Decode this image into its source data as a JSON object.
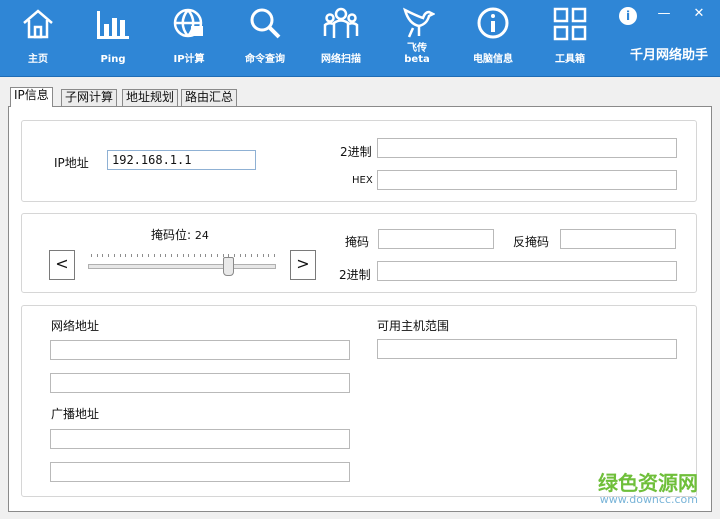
{
  "toolbar": {
    "items": [
      {
        "label": "主页",
        "icon": "home-icon"
      },
      {
        "label": "Ping",
        "icon": "bar-chart-icon"
      },
      {
        "label": "IP计算",
        "icon": "globe-icon"
      },
      {
        "label": "命令查询",
        "icon": "search-icon"
      },
      {
        "label": "网络扫描",
        "icon": "people-icon"
      },
      {
        "label_line1": "飞传",
        "label_line2": "beta",
        "icon": "dove-icon"
      },
      {
        "label": "电脑信息",
        "icon": "info-icon"
      },
      {
        "label": "工具箱",
        "icon": "grid-icon"
      }
    ],
    "brand": "千月网络助手",
    "info_button": "i",
    "minimize_button": "—",
    "close_button": "✕"
  },
  "tabs": [
    "IP信息",
    "子网计算",
    "地址规划",
    "路由汇总"
  ],
  "ip_section": {
    "ip_label": "IP地址",
    "ip_value": "192.168.1.1",
    "binary_label": "2进制",
    "binary_value": "",
    "hex_label": "HEX",
    "hex_value": ""
  },
  "mask_section": {
    "mask_bits_label": "掩码位:",
    "mask_bits_value": "24",
    "mask_bits_max": 32,
    "prev_button": "<",
    "next_button": ">",
    "mask_label": "掩码",
    "mask_value": "",
    "inverse_mask_label": "反掩码",
    "inverse_mask_value": "",
    "binary_label": "2进制",
    "binary_value": ""
  },
  "result_section": {
    "network_label": "网络地址",
    "broadcast_label": "广播地址",
    "host_range_label": "可用主机范围"
  },
  "watermark": {
    "line1": "绿色资源网",
    "line2": "www.downcc.com"
  },
  "colors": {
    "toolbar_bg": "#2f86d6",
    "watermark_green": "#6fbf3a",
    "watermark_blue": "#79b4d8"
  }
}
